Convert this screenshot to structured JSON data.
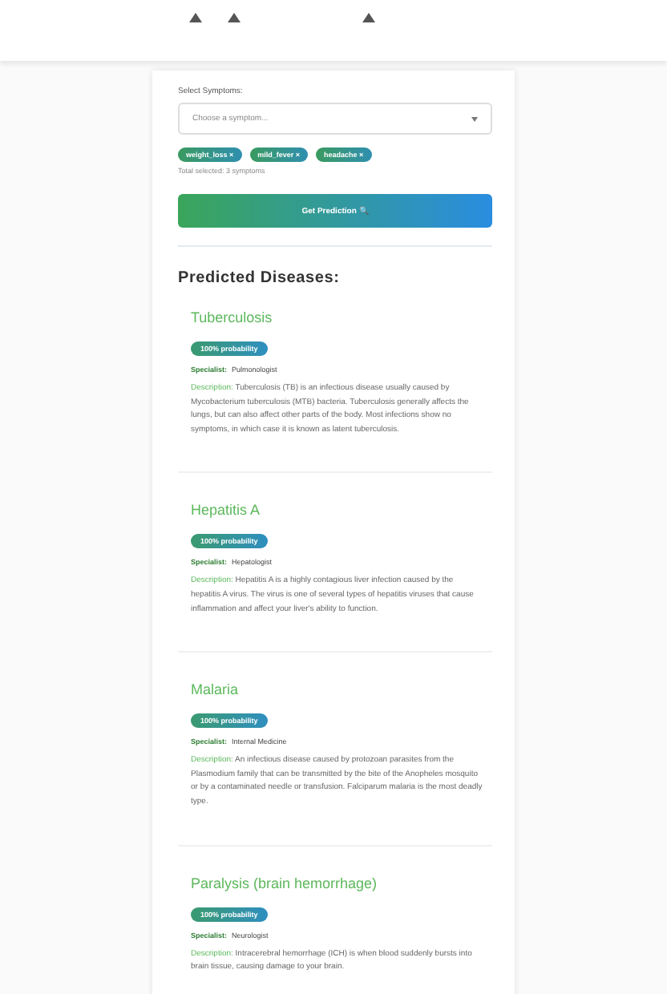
{
  "symptoms": {
    "label": "Select Symptoms:",
    "placeholder": "Choose a symptom...",
    "chips": [
      {
        "text": "weight_loss ×"
      },
      {
        "text": "mild_fever ×"
      },
      {
        "text": "headache ×"
      }
    ],
    "count": "Total selected: 3 symptoms"
  },
  "predict_button": "Get Prediction 🔍",
  "results_title": "Predicted Diseases:",
  "diseases": [
    {
      "name": "Tuberculosis",
      "probability": "100% probability",
      "specialist_label": "Specialist:",
      "specialist": "Pulmonologist",
      "description_label": "Description:",
      "description": "Tuberculosis (TB) is an infectious disease usually caused by Mycobacterium tuberculosis (MTB) bacteria. Tuberculosis generally affects the lungs, but can also affect other parts of the body. Most infections show no symptoms, in which case it is known as latent tuberculosis."
    },
    {
      "name": "Hepatitis A",
      "probability": "100% probability",
      "specialist_label": "Specialist:",
      "specialist": "Hepatologist",
      "description_label": "Description:",
      "description": "Hepatitis A is a highly contagious liver infection caused by the hepatitis A virus. The virus is one of several types of hepatitis viruses that cause inflammation and affect your liver's ability to function."
    },
    {
      "name": "Malaria",
      "probability": "100% probability",
      "specialist_label": "Specialist:",
      "specialist": "Internal Medicine",
      "description_label": "Description:",
      "description": "An infectious disease caused by protozoan parasites from the Plasmodium family that can be transmitted by the bite of the Anopheles mosquito or by a contaminated needle or transfusion. Falciparum malaria is the most deadly type."
    },
    {
      "name": "Paralysis (brain hemorrhage)",
      "probability": "100% probability",
      "specialist_label": "Specialist:",
      "specialist": "Neurologist",
      "description_label": "Description:",
      "description": "Intracerebral hemorrhage (ICH) is when blood suddenly bursts into brain tissue, causing damage to your brain."
    }
  ]
}
